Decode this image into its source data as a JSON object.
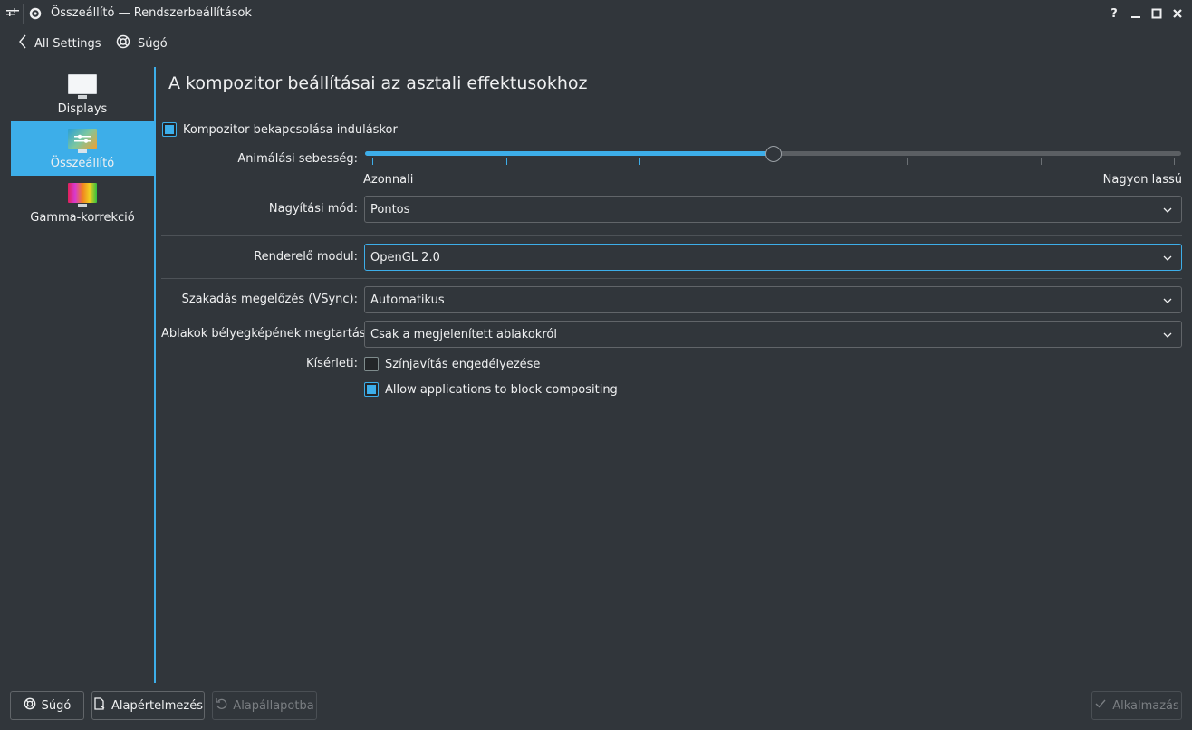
{
  "window": {
    "title": "Összeállító  — Rendszerbeállítások"
  },
  "nav": {
    "back_label": "All Settings",
    "help_label": "Súgó"
  },
  "sidebar": {
    "items": [
      {
        "label": "Displays",
        "icon": "monitor-icon",
        "selected": false
      },
      {
        "label": "Összeállító",
        "icon": "compositor-icon",
        "selected": true
      },
      {
        "label": "Gamma-korrekció",
        "icon": "gamma-monitor-icon",
        "selected": false
      }
    ]
  },
  "content": {
    "heading": "A kompozitor beállításai az asztali effektusokhoz",
    "enable_on_startup": {
      "label": "Kompozitor bekapcsolása induláskor",
      "checked": true
    },
    "animation_speed": {
      "label": "Animálási sebesség:",
      "min_label": "Azonnali",
      "max_label": "Nagyon lassú",
      "value_fraction": 0.5,
      "ticks": 7
    },
    "scale_method": {
      "label": "Nagyítási mód:",
      "value": "Pontos"
    },
    "rendering_backend": {
      "label": "Renderelő modul:",
      "value": "OpenGL 2.0"
    },
    "vsync": {
      "label": "Szakadás megelőzés (VSync):",
      "value": "Automatikus"
    },
    "thumbnails": {
      "label": "Ablakok bélyegképének megtartása:",
      "value": "Csak a megjelenített ablakokról"
    },
    "experimental": {
      "label": "Kísérleti:",
      "color_correction": {
        "label": "Színjavítás engedélyezése",
        "checked": false
      },
      "allow_block": {
        "label": "Allow applications to block compositing",
        "checked": true
      }
    }
  },
  "footer": {
    "help_label": "Súgó",
    "defaults_label": "Alapértelmezés",
    "reset_label": "Alapállapotba",
    "apply_label": "Alkalmazás"
  },
  "colors": {
    "accent": "#3daee9",
    "background": "#31363b",
    "text": "#eff0f1"
  }
}
